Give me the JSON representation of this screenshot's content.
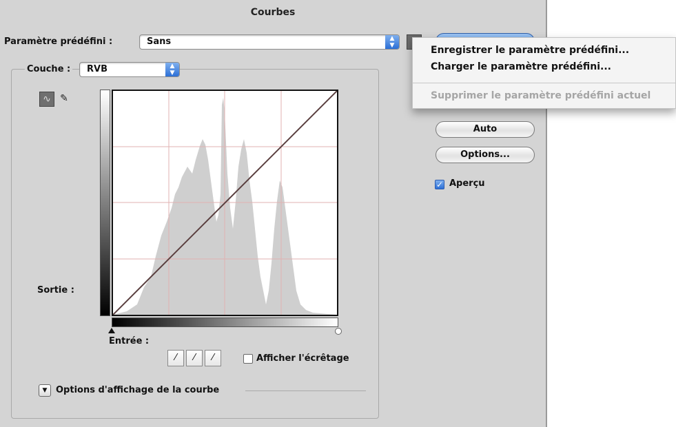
{
  "dialog": {
    "title": "Courbes",
    "preset": {
      "label": "Paramètre prédéfini :",
      "value": "Sans"
    },
    "channel": {
      "label": "Couche :",
      "value": "RVB"
    },
    "output_label": "Sortie :",
    "input_label": "Entrée :",
    "buttons": {
      "auto": "Auto",
      "options": "Options..."
    },
    "preview": {
      "label": "Aperçu",
      "checked": true
    },
    "clipping": {
      "label": "Afficher l'écrêtage",
      "checked": false
    },
    "curve_display_options": "Options d'affichage de la courbe"
  },
  "preset_menu": {
    "items": [
      {
        "label": "Enregistrer le paramètre prédéfini...",
        "enabled": true
      },
      {
        "label": "Charger le paramètre prédéfini...",
        "enabled": true
      },
      {
        "label": "Supprimer le paramètre prédéfini actuel",
        "enabled": false
      }
    ]
  },
  "colors": {
    "dialog_bg": "#d4d4d4",
    "accent_blue": "#2c6fd6",
    "histogram": "#cfcfcf",
    "curve": "#5a3f3f"
  },
  "icons": {
    "curve_tool": "curve-point-icon",
    "pencil_tool": "pencil-icon",
    "eyedroppers": [
      "black-eyedropper-icon",
      "gray-eyedropper-icon",
      "white-eyedropper-icon"
    ],
    "disclosure": "disclosure-triangle-icon"
  }
}
